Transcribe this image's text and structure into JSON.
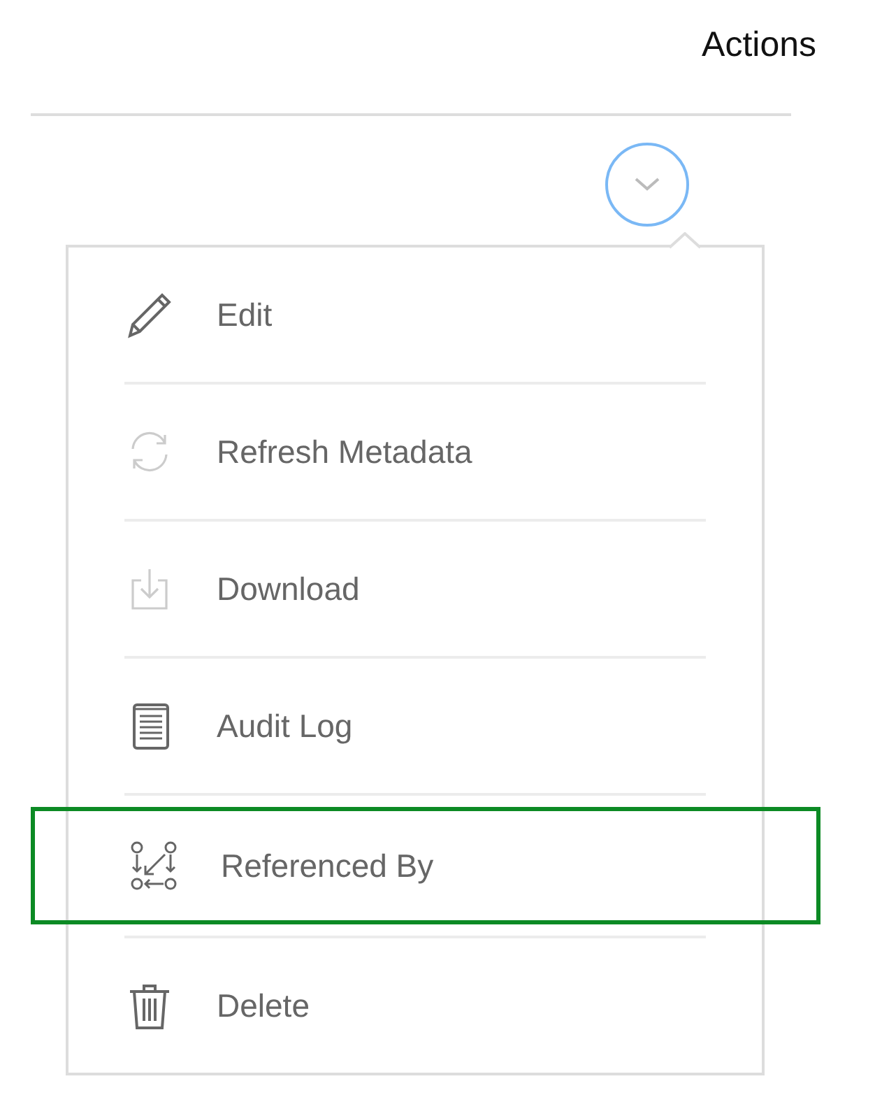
{
  "header": {
    "title": "Actions"
  },
  "menu": {
    "items": [
      {
        "label": "Edit",
        "kind": "pencil",
        "disabled": false,
        "highlighted": false
      },
      {
        "label": "Refresh Metadata",
        "kind": "refresh",
        "disabled": true,
        "highlighted": false
      },
      {
        "label": "Download",
        "kind": "download",
        "disabled": true,
        "highlighted": false
      },
      {
        "label": "Audit Log",
        "kind": "log",
        "disabled": false,
        "highlighted": false
      },
      {
        "label": "Referenced By",
        "kind": "refs",
        "disabled": false,
        "highlighted": true
      },
      {
        "label": "Delete",
        "kind": "trash",
        "disabled": false,
        "highlighted": false
      }
    ]
  }
}
